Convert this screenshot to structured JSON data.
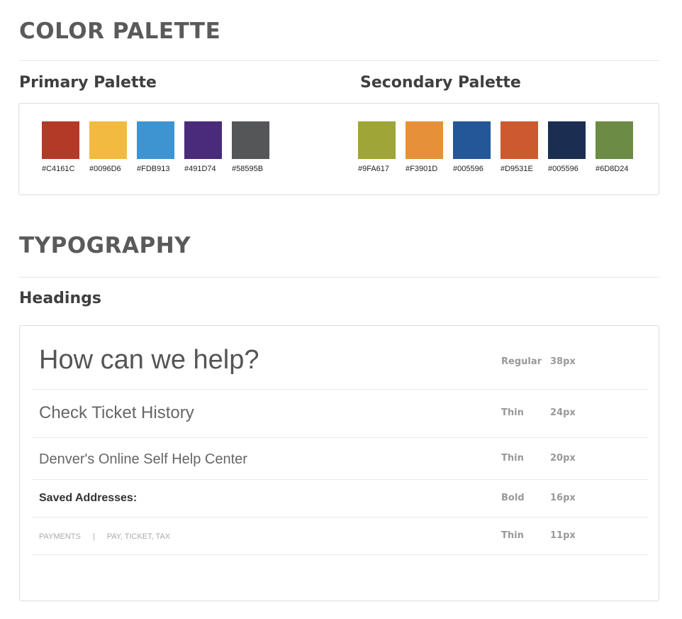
{
  "color_section": {
    "title": "COLOR PALETTE",
    "primary": {
      "title": "Primary Palette",
      "swatches": [
        {
          "code": "#C4161C",
          "color": "#B23A26"
        },
        {
          "code": "#0096D6",
          "color": "#F3BA41"
        },
        {
          "code": "#FDB913",
          "color": "#3E94D1"
        },
        {
          "code": "#491D74",
          "color": "#4A2A7A"
        },
        {
          "code": "#58595B",
          "color": "#555658"
        }
      ]
    },
    "secondary": {
      "title": "Secondary Palette",
      "swatches": [
        {
          "code": "#9FA617",
          "color": "#9FA537"
        },
        {
          "code": "#F3901D",
          "color": "#E6913A"
        },
        {
          "code": "#005596",
          "color": "#245796"
        },
        {
          "code": "#D9531E",
          "color": "#CC5A2E"
        },
        {
          "code": "#005596",
          "color": "#1B2E52"
        },
        {
          "code": "#6D8D24",
          "color": "#6C8C45"
        }
      ]
    }
  },
  "typography_section": {
    "title": "TYPOGRAPHY",
    "headings": {
      "title": "Headings",
      "rows": [
        {
          "sample": "How can we help?",
          "weight": "Regular",
          "size": "38px"
        },
        {
          "sample": "Check Ticket History",
          "weight": "Thin",
          "size": "24px"
        },
        {
          "sample": "Denver's Online Self Help Center",
          "weight": "Thin",
          "size": "20px"
        },
        {
          "sample": "Saved Addresses:",
          "weight": "Bold",
          "size": "16px"
        },
        {
          "sample_left": "PAYMENTS",
          "sample_divider": "|",
          "sample_right": "PAY, TICKET, TAX",
          "weight": "Thin",
          "size": "11px"
        }
      ]
    }
  }
}
